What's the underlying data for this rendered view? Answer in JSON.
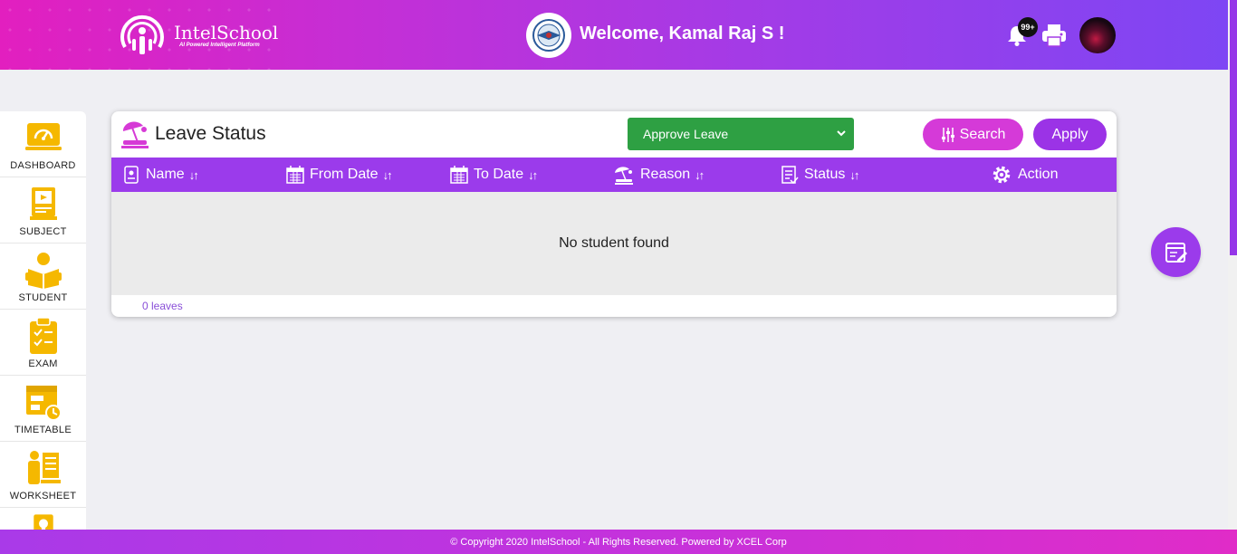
{
  "header": {
    "logo_name": "IntelSchool",
    "logo_tagline": "AI Powered Intelligent Platform",
    "welcome": "Welcome, Kamal Raj S !",
    "notification_count": "99+"
  },
  "sidebar": {
    "items": [
      {
        "label": "DASHBOARD",
        "icon": "dashboard-icon"
      },
      {
        "label": "SUBJECT",
        "icon": "subject-icon"
      },
      {
        "label": "STUDENT",
        "icon": "student-icon"
      },
      {
        "label": "EXAM",
        "icon": "exam-icon"
      },
      {
        "label": "TIMETABLE",
        "icon": "timetable-icon"
      },
      {
        "label": "WORKSHEET",
        "icon": "worksheet-icon"
      }
    ]
  },
  "card": {
    "title": "Leave Status",
    "select_value": "Approve Leave",
    "search_label": "Search",
    "apply_label": "Apply",
    "columns": [
      "Name",
      "From Date",
      "To Date",
      "Reason",
      "Status",
      "Action"
    ],
    "sort_glyph": "↓↑",
    "empty_message": "No student found",
    "footer_count": "0 leaves"
  },
  "footer": {
    "copyright": "© Copyright 2020 IntelSchool - All Rights Reserved. Powered by XCEL Corp"
  },
  "colors": {
    "accent": "#9b3beb",
    "header_start": "#e21fbf",
    "header_end": "#7d46f4",
    "select_green": "#2ea043",
    "sidebar_icon": "#f5b800"
  }
}
